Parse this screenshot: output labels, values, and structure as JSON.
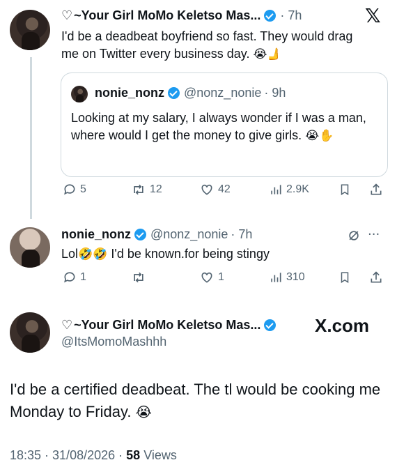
{
  "tweet1": {
    "heart_prefix": "♡",
    "author_name": "~Your Girl MoMo Keletso Mas...",
    "time": "· 7h",
    "text": "I'd be a deadbeat boyfriend so fast. They would drag me on Twitter every business day.",
    "emoji": "😭🫸"
  },
  "quoted": {
    "author_name": "nonie_nonz",
    "handle": "@nonz_nonie",
    "time": "· 9h",
    "text": "Looking at my salary, I always wonder if I was a man, where would I get the money to give girls.",
    "emoji": "😭✋"
  },
  "tweet1_actions": {
    "replies": "5",
    "retweets": "12",
    "likes": "42",
    "views": "2.9K"
  },
  "tweet2": {
    "author_name": "nonie_nonz",
    "handle": "@nonz_nonie",
    "time": "· 7h",
    "text_prefix": "Lol",
    "emoji": "🤣🤣",
    "text_suffix": " I'd be known.for being stingy"
  },
  "tweet2_actions": {
    "replies": "1",
    "retweets": "",
    "likes": "1",
    "views": "310"
  },
  "tweet3": {
    "heart_prefix": "♡",
    "author_name": "~Your Girl MoMo Keletso Mas...",
    "handle": "@ItsMomoMashhh",
    "text": "I'd be a certified deadbeat. The tl would be cooking me Monday to Friday.",
    "emoji": "😭",
    "timestamp": "18:35 · 31/08/2026 ·",
    "views_count": "58",
    "views_label": "Views"
  },
  "brand": {
    "x_logo": "𝕏",
    "x_com": "X.com"
  },
  "icons": {
    "reply": "reply-icon",
    "retweet": "retweet-icon",
    "like": "heart-icon",
    "views": "views-icon",
    "bookmark": "bookmark-icon",
    "share": "share-icon"
  },
  "colors": {
    "verified": "#1d9bf0",
    "muted": "#536471",
    "text": "#0f1419"
  }
}
